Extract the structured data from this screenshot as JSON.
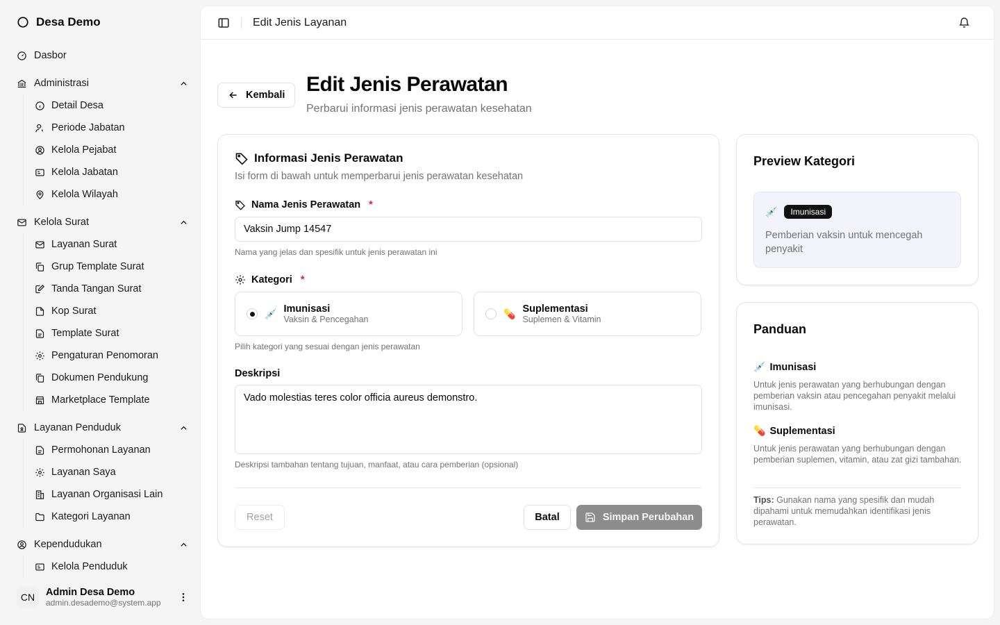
{
  "sidebar": {
    "brand": "Desa Demo",
    "dashboard": "Dasbor",
    "groups": [
      {
        "label": "Administrasi",
        "items": [
          "Detail Desa",
          "Periode Jabatan",
          "Kelola Pejabat",
          "Kelola Jabatan",
          "Kelola Wilayah"
        ]
      },
      {
        "label": "Kelola Surat",
        "items": [
          "Layanan Surat",
          "Grup Template Surat",
          "Tanda Tangan Surat",
          "Kop Surat",
          "Template Surat",
          "Pengaturan Penomoran",
          "Dokumen Pendukung",
          "Marketplace Template"
        ]
      },
      {
        "label": "Layanan Penduduk",
        "items": [
          "Permohonan Layanan",
          "Layanan Saya",
          "Layanan Organisasi Lain",
          "Kategori Layanan"
        ]
      },
      {
        "label": "Kependudukan",
        "items": [
          "Kelola Penduduk"
        ]
      }
    ],
    "user": {
      "initials": "CN",
      "name": "Admin Desa Demo",
      "email": "admin.desademo@system.app"
    }
  },
  "topbar": {
    "title": "Edit Jenis Layanan"
  },
  "page": {
    "back_label": "Kembali",
    "title": "Edit Jenis Perawatan",
    "subtitle": "Perbarui informasi jenis perawatan kesehatan"
  },
  "form": {
    "title": "Informasi Jenis Perawatan",
    "description": "Isi form di bawah untuk memperbarui jenis perawatan kesehatan",
    "name_label": "Nama Jenis Perawatan",
    "required_mark": "*",
    "name_value": "Vaksin Jump 14547",
    "name_hint": "Nama yang jelas dan spesifik untuk jenis perawatan ini",
    "category_label": "Kategori",
    "categories": [
      {
        "emoji": "💉",
        "title": "Imunisasi",
        "sub": "Vaksin & Pencegahan",
        "selected": true
      },
      {
        "emoji": "💊",
        "title": "Suplementasi",
        "sub": "Suplemen & Vitamin",
        "selected": false
      }
    ],
    "category_hint": "Pilih kategori yang sesuai dengan jenis perawatan",
    "desc_label": "Deskripsi",
    "desc_value": "Vado molestias teres color officia aureus demonstro.",
    "desc_hint": "Deskripsi tambahan tentang tujuan, manfaat, atau cara pemberian (opsional)",
    "reset_label": "Reset",
    "cancel_label": "Batal",
    "save_label": "Simpan Perubahan"
  },
  "preview": {
    "title": "Preview Kategori",
    "emoji": "💉",
    "badge": "Imunisasi",
    "text": "Pemberian vaksin untuk mencegah penyakit"
  },
  "guide": {
    "title": "Panduan",
    "items": [
      {
        "emoji": "💉",
        "title": "Imunisasi",
        "text": "Untuk jenis perawatan yang berhubungan dengan pemberian vaksin atau pencegahan penyakit melalui imunisasi."
      },
      {
        "emoji": "💊",
        "title": "Suplementasi",
        "text": "Untuk jenis perawatan yang berhubungan dengan pemberian suplemen, vitamin, atau zat gizi tambahan."
      }
    ],
    "tip_label": "Tips:",
    "tip_text": "Gunakan nama yang spesifik dan mudah dipahami untuk memudahkan identifikasi jenis perawatan."
  }
}
